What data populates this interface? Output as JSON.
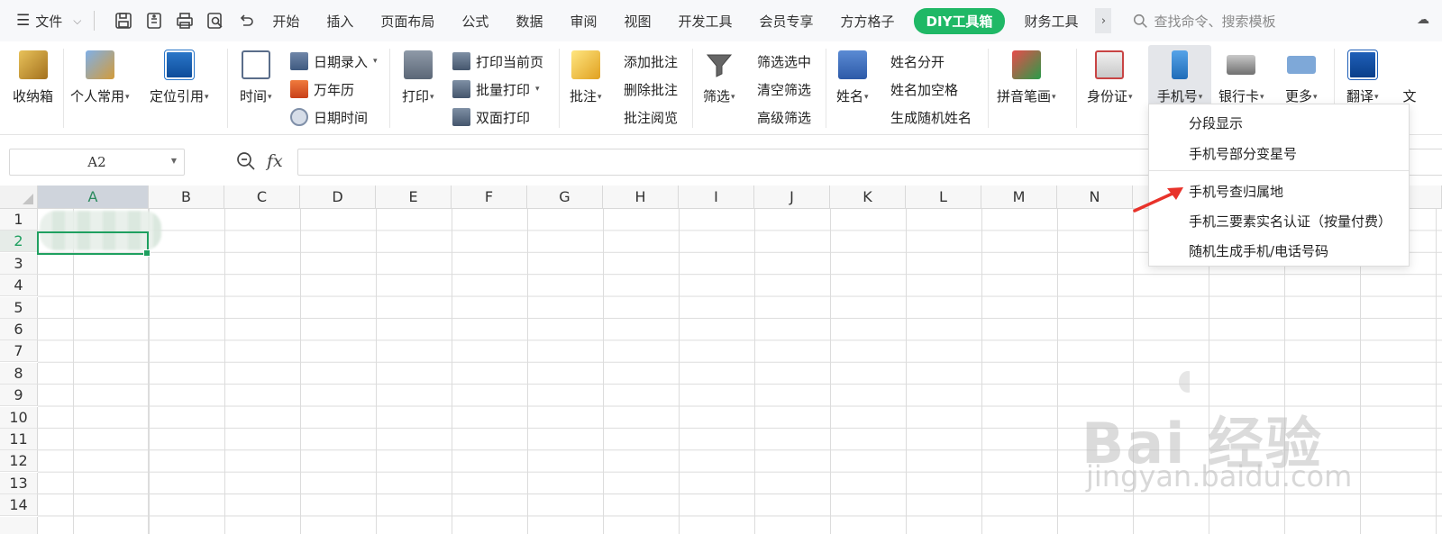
{
  "menubar": {
    "file_label": "文件",
    "tabs": [
      "开始",
      "插入",
      "页面布局",
      "公式",
      "数据",
      "审阅",
      "视图",
      "开发工具",
      "会员专享",
      "方方格子",
      "DIY工具箱",
      "财务工具"
    ],
    "search_placeholder": "查找命令、搜索模板",
    "accent_color": "#1fb866"
  },
  "ribbon": {
    "shouna": "收纳箱",
    "personal": "个人常用",
    "locate": "定位引用",
    "time": "时间",
    "date_entry": "日期录入",
    "calendar": "万年历",
    "datetime": "日期时间",
    "print": "打印",
    "print_current": "打印当前页",
    "batch_print": "批量打印",
    "duplex_print": "双面打印",
    "comment": "批注",
    "add_comment": "添加批注",
    "delete_comment": "删除批注",
    "view_comment": "批注阅览",
    "filter": "筛选",
    "filter_selected": "筛选选中",
    "clear_filter": "清空筛选",
    "advanced_filter": "高级筛选",
    "name": "姓名",
    "name_split": "姓名分开",
    "name_space": "姓名加空格",
    "random_name": "生成随机姓名",
    "pinyin": "拼音笔画",
    "id_card": "身份证",
    "phone": "手机号",
    "bank_card": "银行卡",
    "more": "更多",
    "translate": "翻译",
    "text_cut": "文"
  },
  "formula_bar": {
    "cell_ref": "A2",
    "fx": "fx",
    "content": ""
  },
  "grid": {
    "columns": [
      "A",
      "B",
      "C",
      "D",
      "E",
      "F",
      "G",
      "H",
      "I",
      "J",
      "K",
      "L",
      "M",
      "N"
    ],
    "rows": [
      "1",
      "2",
      "3",
      "4",
      "5",
      "6",
      "7",
      "8",
      "9",
      "10",
      "11",
      "12",
      "13",
      "14"
    ],
    "selected_cell": "A2",
    "select_color": "#1fa060"
  },
  "phone_menu": {
    "items": [
      "分段显示",
      "手机号部分变星号",
      "手机号查归属地",
      "手机三要素实名认证（按量付费）",
      "随机生成手机/电话号码"
    ]
  },
  "watermark": {
    "brand": "Bai 经验",
    "url": "jingyan.baidu.com"
  }
}
